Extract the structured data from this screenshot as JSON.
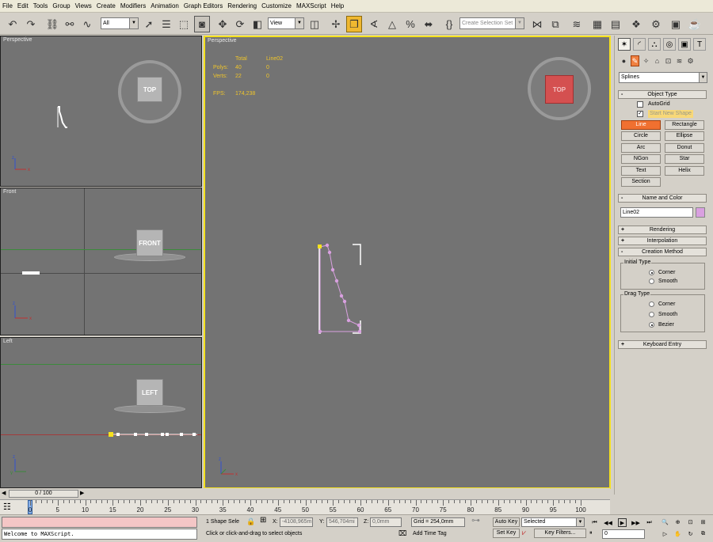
{
  "menu": [
    "File",
    "Edit",
    "Tools",
    "Group",
    "Views",
    "Create",
    "Modifiers",
    "Animation",
    "Graph Editors",
    "Rendering",
    "Customize",
    "MAXScript",
    "Help"
  ],
  "toolbar": {
    "selection_filter": "All",
    "ref_coord": "View",
    "named_selection_placeholder": "Create Selection Set",
    "icons": [
      "undo-icon",
      "redo-icon",
      "select-link-icon",
      "unlink-icon",
      "bind-space-warp-icon",
      "select-object-icon",
      "select-by-name-icon",
      "rect-selection-icon",
      "window-crossing-icon",
      "move-icon",
      "rotate-icon",
      "scale-icon",
      "pivot-icon",
      "manipulate-icon",
      "snap-toggle-icon",
      "angle-snap-icon",
      "percent-snap-icon",
      "spinner-snap-icon",
      "edit-named-selection-icon",
      "mirror-icon",
      "align-icon",
      "layer-manager-icon",
      "curve-editor-icon",
      "schematic-view-icon",
      "material-editor-icon",
      "render-setup-icon",
      "rendered-frame-icon",
      "quick-render-icon"
    ]
  },
  "viewports": {
    "top_left": {
      "label": "Perspective",
      "cube": "TOP"
    },
    "front": {
      "label": "Front",
      "cube": "FRONT"
    },
    "left": {
      "label": "Left",
      "cube": "LEFT"
    },
    "main": {
      "label": "Perspective",
      "cube": "TOP"
    }
  },
  "stats": {
    "header_total": "Total",
    "header_obj": "Line02",
    "polys_label": "Polys:",
    "polys_total": "40",
    "polys_obj": "0",
    "verts_label": "Verts:",
    "verts_total": "22",
    "verts_obj": "0",
    "fps_label": "FPS:",
    "fps_value": "174,238"
  },
  "command_panel": {
    "category": "Splines",
    "object_type_title": "Object Type",
    "autogrid": "AutoGrid",
    "start_new_shape": "Start New Shape",
    "buttons": [
      "Line",
      "Rectangle",
      "Circle",
      "Ellipse",
      "Arc",
      "Donut",
      "NGon",
      "Star",
      "Text",
      "Helix",
      "Section"
    ],
    "name_color_title": "Name and Color",
    "object_name": "Line02",
    "object_color": "#d9a0e0",
    "rollouts": [
      "Rendering",
      "Interpolation",
      "Creation Method"
    ],
    "initial_type_title": "Initial Type",
    "initial_types": [
      "Corner",
      "Smooth"
    ],
    "drag_type_title": "Drag Type",
    "drag_types": [
      "Corner",
      "Smooth",
      "Bezier"
    ],
    "keyboard_entry": "Keyboard Entry"
  },
  "timeline": {
    "frame_display": "0 / 100",
    "ticks": [
      "0",
      "5",
      "10",
      "15",
      "20",
      "25",
      "30",
      "35",
      "40",
      "45",
      "50",
      "55",
      "60",
      "65",
      "70",
      "75",
      "80",
      "85",
      "90",
      "95",
      "100"
    ]
  },
  "status": {
    "listener_text": "Welcome to MAXScript.",
    "selection_info": "1 Shape Sele",
    "x_label": "X:",
    "x_value": "-4108,965m",
    "y_label": "Y:",
    "y_value": "546,704mi",
    "z_label": "Z:",
    "z_value": "0,0mm",
    "grid": "Grid = 254,0mm",
    "prompt": "Click or click-and-drag to select objects",
    "add_time_tag": "Add Time Tag",
    "auto_key": "Auto Key",
    "set_key": "Set Key",
    "selected": "Selected",
    "key_filters": "Key Filters...",
    "frame": "0"
  }
}
